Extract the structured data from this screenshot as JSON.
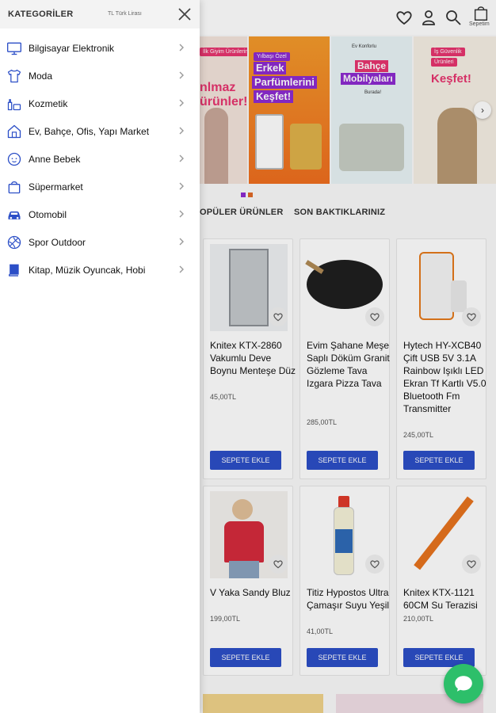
{
  "drawer": {
    "title": "KATEGORİLER",
    "lang": "TL  Türk Lirası",
    "categories": [
      {
        "label": "Bilgisayar Elektronik",
        "icon": "monitor-icon"
      },
      {
        "label": "Moda",
        "icon": "tshirt-icon"
      },
      {
        "label": "Kozmetik",
        "icon": "cosmetics-icon"
      },
      {
        "label": "Ev, Bahçe, Ofis, Yapı Market",
        "icon": "home-icon"
      },
      {
        "label": "Anne Bebek",
        "icon": "baby-icon"
      },
      {
        "label": "Süpermarket",
        "icon": "shopping-bag-icon"
      },
      {
        "label": "Otomobil",
        "icon": "car-icon"
      },
      {
        "label": "Spor Outdoor",
        "icon": "ball-icon"
      },
      {
        "label": "Kitap, Müzik Oyuncak, Hobi",
        "icon": "book-icon"
      }
    ]
  },
  "header": {
    "cart_label": "Sepetim"
  },
  "banners": [
    {
      "small": "İlk Giyim Ürünlerinde",
      "big": "nlmaz ürünler!"
    },
    {
      "small": "Yılbaşı Özel",
      "big1": "Erkek",
      "big2": "Parfümlerini",
      "big3": "Keşfet!"
    },
    {
      "small": "Ev Konforlu",
      "big1": "Bahçe",
      "big2": "Mobilyaları",
      "tail": "Burada!"
    },
    {
      "small1": "İş Güvenlik",
      "small2": "Ürünleri",
      "big": "Keşfet!"
    }
  ],
  "tabs": [
    "POPÜLER ÜRÜNLER",
    "SON BAKTIKLARINIZ"
  ],
  "tab_visible_first": "OPÜLER ÜRÜNLER",
  "products": [
    {
      "name": "Knitex KTX-2860 Vakumlu Deve Boynu Menteşe Düz",
      "price": "45,00TL",
      "button": "SEPETE EKLE"
    },
    {
      "name": "Evim Şahane Meşe Saplı Döküm Granit Gözleme Tava Izgara Pizza Tava",
      "price": "285,00TL",
      "button": "SEPETE EKLE"
    },
    {
      "name": "Hytech HY-XCB40 Çift USB 5V 3.1A Rainbow Işıklı LED Ekran Tf Kartlı V5.0 Bluetooth Fm Transmitter",
      "price": "245,00TL",
      "button": "SEPETE EKLE"
    },
    {
      "name": "V Yaka Sandy Bluz",
      "price": "199,00TL",
      "button": "SEPETE EKLE"
    },
    {
      "name": "Titiz Hypostos Ultra Çamaşır Suyu Yeşil",
      "price": "41,00TL",
      "button": "SEPETE EKLE"
    },
    {
      "name": "Knitex KTX-1121 60CM Su Terazisi",
      "price": "210,00TL",
      "button": "SEPETE EKLE"
    }
  ],
  "colors": {
    "accent": "#2c4fc7",
    "chat": "#2dbf6a",
    "banner_purple": "#8e2bd1",
    "banner_orange": "#f28a1c",
    "banner_pink": "#e8356f"
  }
}
